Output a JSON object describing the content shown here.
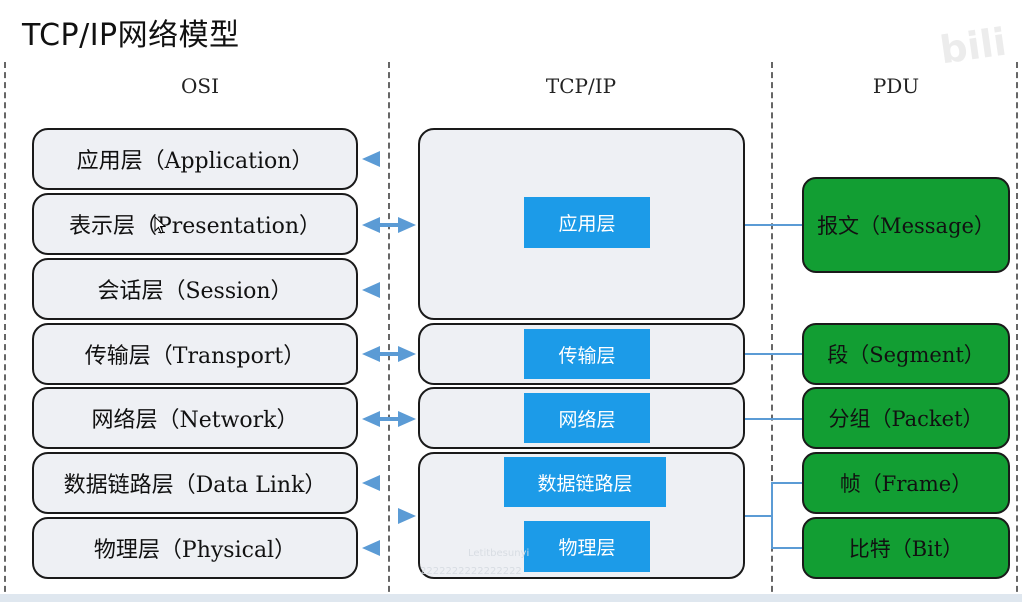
{
  "title": "TCP/IP网络模型",
  "headers": {
    "osi": "OSI",
    "tcpip": "TCP/IP",
    "pdu": "PDU"
  },
  "osi_layers": [
    "应用层（Application）",
    "表示层（Presentation）",
    "会话层（Session）",
    "传输层（Transport）",
    "网络层（Network）",
    "数据链路层（Data Link）",
    "物理层（Physical）"
  ],
  "tcpip_layers": [
    "应用层",
    "传输层",
    "网络层",
    "数据链路层",
    "物理层"
  ],
  "pdu_units": [
    "报文（Message）",
    "段（Segment）",
    "分组（Packet）",
    "帧（Frame）",
    "比特（Bit）"
  ],
  "colors": {
    "tcp_label_fill": "#1c9be8",
    "pdu_fill": "#129e33",
    "box_fill": "#eef0f4",
    "arrow": "#5b9bd5"
  },
  "watermark": "bili"
}
